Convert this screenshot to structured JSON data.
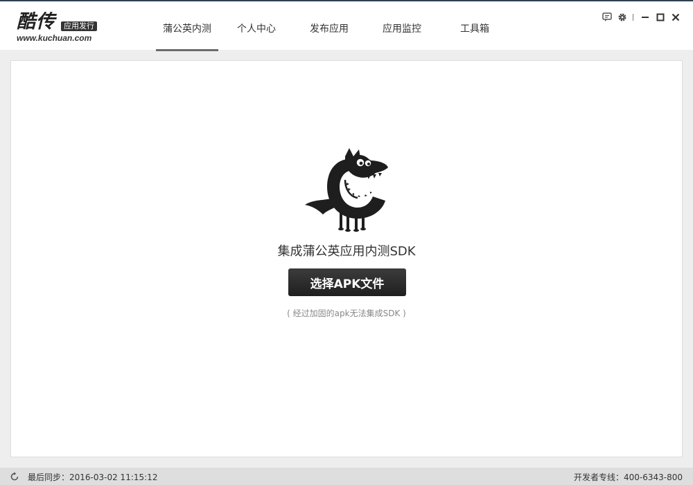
{
  "brand": {
    "name": "酷传",
    "badge": "应用发行",
    "url": "www.kuchuan.com"
  },
  "nav": {
    "items": [
      {
        "label": "蒲公英内测",
        "active": true
      },
      {
        "label": "个人中心"
      },
      {
        "label": "发布应用"
      },
      {
        "label": "应用监控"
      },
      {
        "label": "工具箱"
      }
    ]
  },
  "window_controls": [
    "feedback-icon",
    "settings-gear-icon",
    "minimize-icon",
    "maximize-icon",
    "close-icon"
  ],
  "main": {
    "headline": "集成蒲公英应用内测SDK",
    "button_label": "选择APK文件",
    "note": "( 经过加固的apk无法集成SDK )"
  },
  "status": {
    "sync": "最后同步：2016-03-02 11:15:12",
    "hotline": "开发者专线：400-6343-800"
  },
  "colors": {
    "header_top_border": "#2f3f52",
    "button": "#262626",
    "active_tab_underline": "#6b6b6b"
  }
}
